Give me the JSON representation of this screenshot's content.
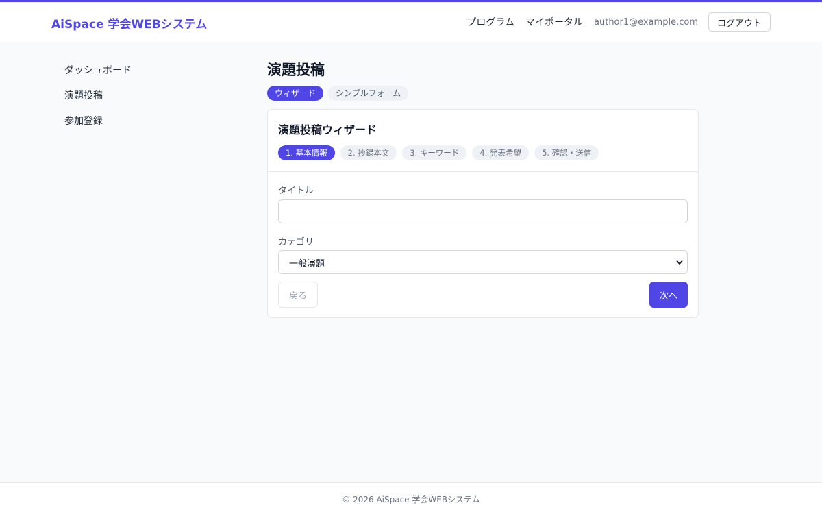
{
  "header": {
    "brand": "AiSpace 学会WEBシステム",
    "nav": {
      "program": "プログラム",
      "my_portal": "マイポータル"
    },
    "user_email": "author1@example.com",
    "logout_label": "ログアウト"
  },
  "sidebar": {
    "items": [
      {
        "label": "ダッシュボード"
      },
      {
        "label": "演題投稿"
      },
      {
        "label": "参加登録"
      }
    ]
  },
  "main": {
    "title": "演題投稿",
    "mode_tabs": [
      {
        "label": "ウィザード",
        "active": true
      },
      {
        "label": "シンプルフォーム",
        "active": false
      }
    ],
    "wizard": {
      "title": "演題投稿ウィザード",
      "steps": [
        {
          "label": "1. 基本情報",
          "active": true
        },
        {
          "label": "2. 抄録本文",
          "active": false
        },
        {
          "label": "3. キーワード",
          "active": false
        },
        {
          "label": "4. 発表希望",
          "active": false
        },
        {
          "label": "5. 確認・送信",
          "active": false
        }
      ],
      "fields": {
        "title_label": "タイトル",
        "title_value": "",
        "category_label": "カテゴリ",
        "category_value": "一般演題"
      },
      "back_label": "戻る",
      "next_label": "次へ"
    }
  },
  "footer": {
    "text": "© 2026 AiSpace 学会WEBシステム"
  },
  "colors": {
    "accent": "#4f46e5",
    "background": "#f8fafc",
    "border": "#e5e7eb",
    "pill_inactive": "#eef2f7"
  },
  "icons": {
    "select_chevron": "chevron-down-icon"
  }
}
